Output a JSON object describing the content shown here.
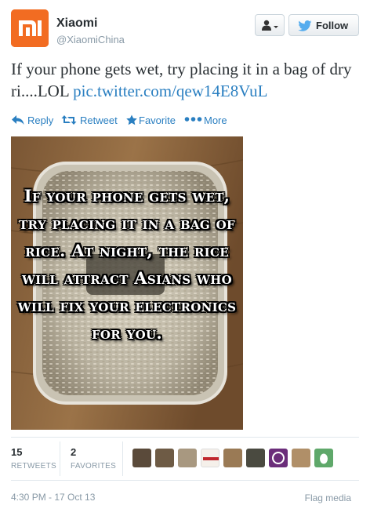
{
  "account": {
    "name": "Xiaomi",
    "handle": "@XiaomiChina",
    "brand_color": "#f26c22"
  },
  "buttons": {
    "user_menu_icon": "user-dropdown-icon",
    "follow_label": "Follow"
  },
  "tweet": {
    "text": "If your phone gets wet, try placing it in a bag of dry ri....LOL ",
    "link": "pic.twitter.com/qew14E8VuL",
    "link_color": "#2a7fc1"
  },
  "actions": [
    {
      "label": "Reply",
      "icon": "reply-icon"
    },
    {
      "label": "Retweet",
      "icon": "retweet-icon"
    },
    {
      "label": "Favorite",
      "icon": "star-icon"
    },
    {
      "label": "More",
      "icon": "more-dots-icon"
    }
  ],
  "image": {
    "caption": "If your phone gets wet, try placing it in a bag of rice. At night, the rice will attract Asians who will fix your electronics for you."
  },
  "stats": {
    "retweets_count": "15",
    "retweets_label": "RETWEETS",
    "favorites_count": "2",
    "favorites_label": "FAVORITES"
  },
  "footer": {
    "timestamp": "4:30 PM - 17 Oct 13",
    "flag_label": "Flag media"
  }
}
